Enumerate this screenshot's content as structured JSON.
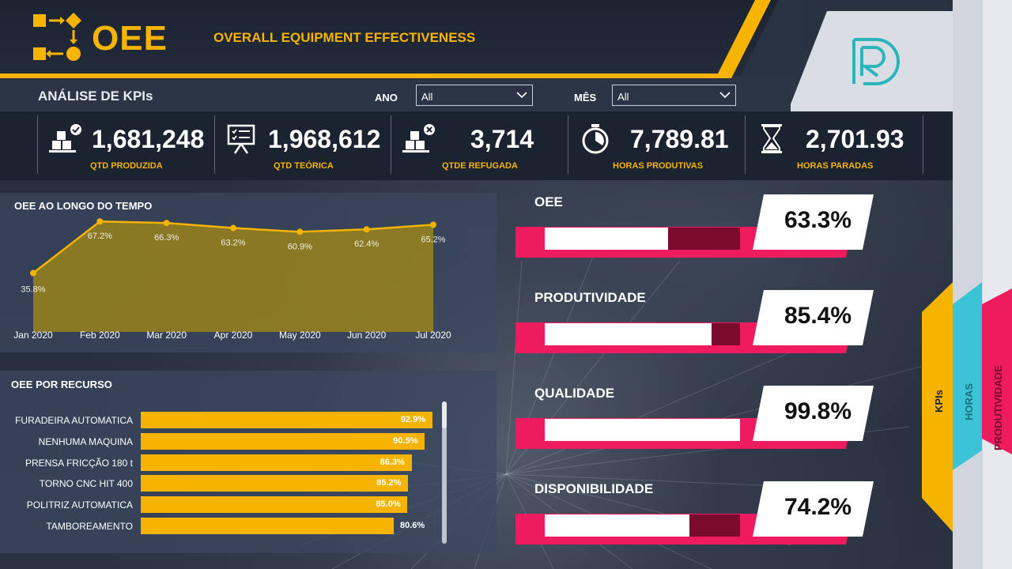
{
  "header": {
    "app_title": "OEE",
    "subtitle": "OVERALL EQUIPMENT EFFECTIVENESS",
    "section_title": "ANÁLISE DE KPIs",
    "brand_logo": "R",
    "filters": {
      "year_label": "ANO",
      "year_value": "All",
      "month_label": "MÊS",
      "month_value": "All"
    }
  },
  "kpis": [
    {
      "value": "1,681,248",
      "label": "QTD PRODUZIDA",
      "icon": "boxes-check-icon"
    },
    {
      "value": "1,968,612",
      "label": "QTD TEÓRICA",
      "icon": "presentation-board-icon"
    },
    {
      "value": "3,714",
      "label": "QTDE REFUGADA",
      "icon": "boxes-x-icon"
    },
    {
      "value": "7,789.81",
      "label": "HORAS PRODUTIVAS",
      "icon": "stopwatch-icon"
    },
    {
      "value": "2,701.93",
      "label": "HORAS PARADAS",
      "icon": "hourglass-icon"
    }
  ],
  "colors": {
    "accent": "#f6b400",
    "pink": "#ee1b5e",
    "track": "#7a0b2e",
    "teal": "#2bb5ba",
    "cyan_tab": "#3cc4d6"
  },
  "chart_data": [
    {
      "type": "area",
      "title": "OEE AO LONGO DO TEMPO",
      "categories": [
        "Jan 2020",
        "Feb 2020",
        "Mar 2020",
        "Apr 2020",
        "May 2020",
        "Jun 2020",
        "Jul 2020"
      ],
      "values": [
        35.8,
        67.2,
        66.3,
        63.2,
        60.9,
        62.4,
        65.2
      ],
      "data_labels": [
        "35.8%",
        "67.2%",
        "66.3%",
        "63.2%",
        "60.9%",
        "62.4%",
        "65.2%"
      ],
      "ylim": [
        0,
        75
      ],
      "grid": false
    },
    {
      "type": "bar",
      "title": "OEE POR RECURSO",
      "categories": [
        "FURADEIRA AUTOMATICA",
        "NENHUMA MAQUINA",
        "PRENSA FRICÇÃO 180 t",
        "TORNO CNC HIT 400",
        "POLITRIZ AUTOMATICA",
        "TAMBOREAMENTO"
      ],
      "values": [
        92.9,
        90.5,
        86.3,
        85.2,
        85.0,
        80.6
      ],
      "data_labels": [
        "92.9%",
        "90.5%",
        "86.3%",
        "85.2%",
        "85.0%",
        "80.6%"
      ],
      "xlim": [
        0,
        100
      ]
    }
  ],
  "metrics": [
    {
      "name": "OEE",
      "value": "63.3%",
      "fraction": 0.633
    },
    {
      "name": "PRODUTIVIDADE",
      "value": "85.4%",
      "fraction": 0.854
    },
    {
      "name": "QUALIDADE",
      "value": "99.8%",
      "fraction": 0.998
    },
    {
      "name": "DISPONIBILIDADE",
      "value": "74.2%",
      "fraction": 0.742
    }
  ],
  "side_tabs": [
    {
      "label": "KPIs",
      "active": true
    },
    {
      "label": "HORAS",
      "active": false
    },
    {
      "label": "PRODUTIVIDADE",
      "active": false
    }
  ]
}
